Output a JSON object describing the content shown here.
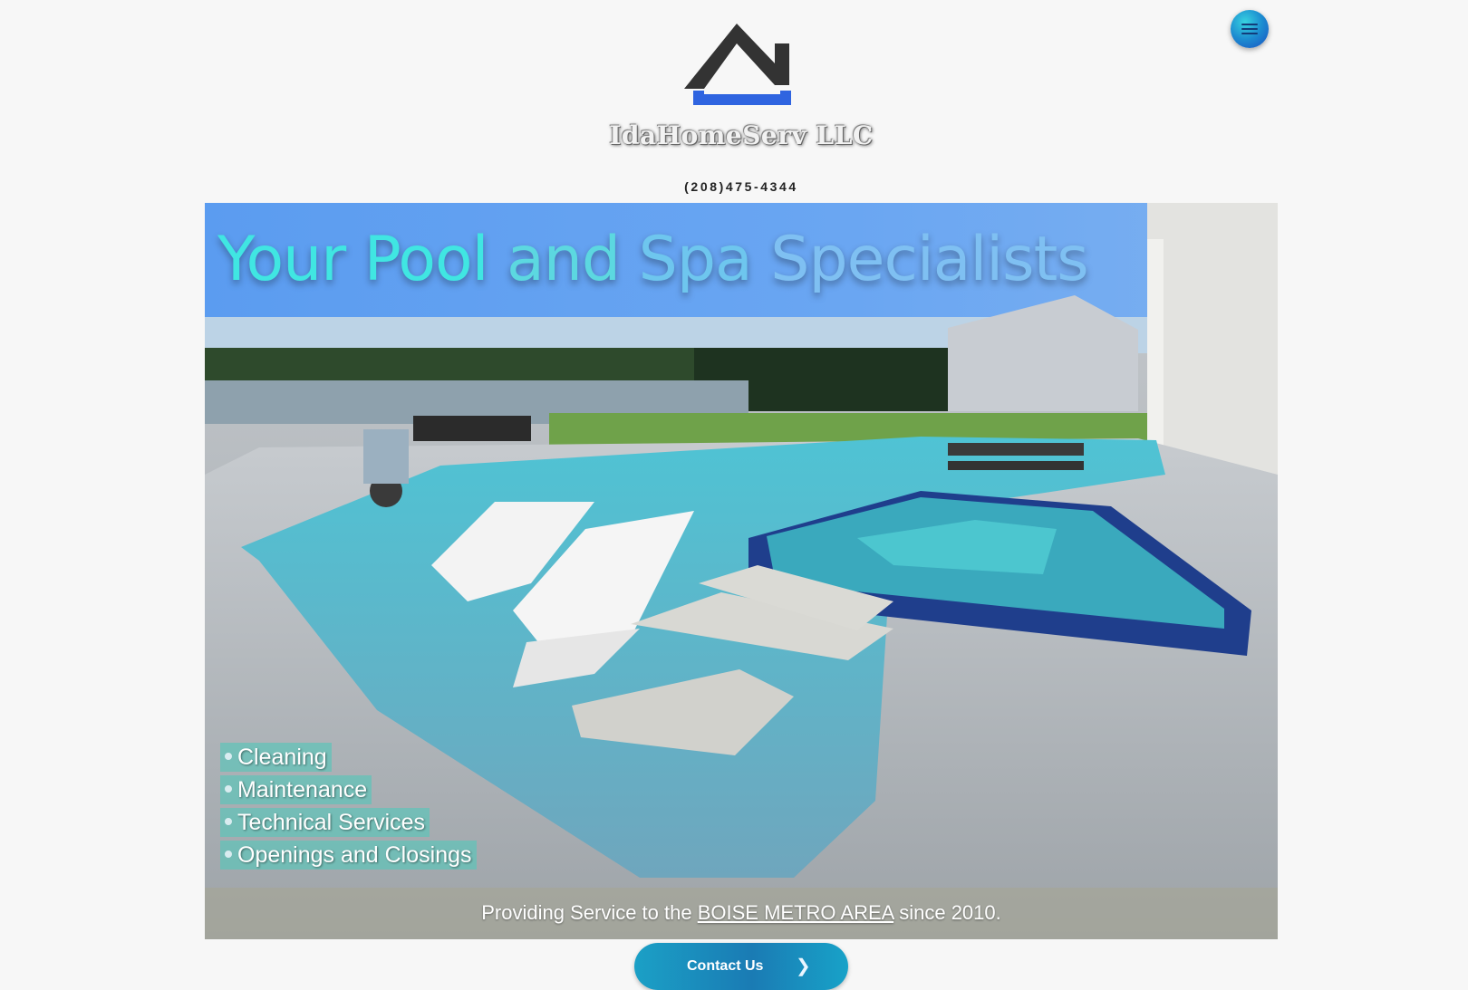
{
  "header": {
    "brand": "IdaHomeServ LLC",
    "phone": "(208)475-4344",
    "menu_icon": "hamburger-menu-icon",
    "logo_icon": "house-roof-icon"
  },
  "hero": {
    "headline_words": [
      "Your Pool",
      "and",
      "Spa",
      "Specialists"
    ],
    "services": [
      "Cleaning",
      "Maintenance",
      "Technical Services",
      "Openings and Closings"
    ],
    "banner": {
      "prefix": "Providing Service to the ",
      "link": "BOISE METRO AREA",
      "suffix": " since 2010."
    }
  },
  "cta": {
    "label": "Contact Us",
    "icon": "chevron-right-icon"
  },
  "colors": {
    "brand_blue": "#2f64e0",
    "accent_teal": "#40e6e2",
    "button": "#1a7bb4"
  }
}
